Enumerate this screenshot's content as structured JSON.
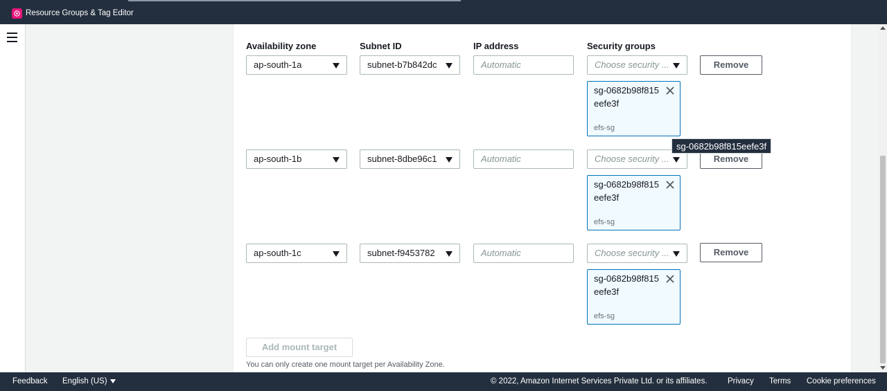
{
  "header": {
    "app_title": "Resource Groups & Tag Editor",
    "colors": {
      "background": "#232f3e",
      "app_icon": "#e7157b"
    }
  },
  "columns": {
    "availability_zone": "Availability zone",
    "subnet_id": "Subnet ID",
    "ip_address": "IP address",
    "security_groups": "Security groups"
  },
  "mount_targets": [
    {
      "az": "ap-south-1a",
      "subnet": "subnet-b7b842dc",
      "ip_placeholder": "Automatic",
      "sg_placeholder": "Choose security ...",
      "sg_token": {
        "id": "sg-0682b98f815eefe3f",
        "name": "efs-sg"
      },
      "remove_label": "Remove"
    },
    {
      "az": "ap-south-1b",
      "subnet": "subnet-8dbe96c1",
      "ip_placeholder": "Automatic",
      "sg_placeholder": "Choose security ...",
      "sg_token": {
        "id": "sg-0682b98f815eefe3f",
        "name": "efs-sg"
      },
      "remove_label": "Remove"
    },
    {
      "az": "ap-south-1c",
      "subnet": "subnet-f9453782",
      "ip_placeholder": "Automatic",
      "sg_placeholder": "Choose security ...",
      "sg_token": {
        "id": "sg-0682b98f815eefe3f",
        "name": "efs-sg"
      },
      "remove_label": "Remove"
    }
  ],
  "tooltip": "sg-0682b98f815eefe3f",
  "add_mount_target_label": "Add mount target",
  "hint": "You can only create one mount target per Availability Zone.",
  "footer": {
    "feedback": "Feedback",
    "language": "English (US)",
    "copyright": "© 2022, Amazon Internet Services Private Ltd. or its affiliates.",
    "privacy": "Privacy",
    "terms": "Terms",
    "cookie_preferences": "Cookie preferences"
  },
  "icons": {
    "app": "resource-groups-icon",
    "menu": "hamburger-menu-icon",
    "caret": "caret-down-icon",
    "close": "close-icon"
  }
}
